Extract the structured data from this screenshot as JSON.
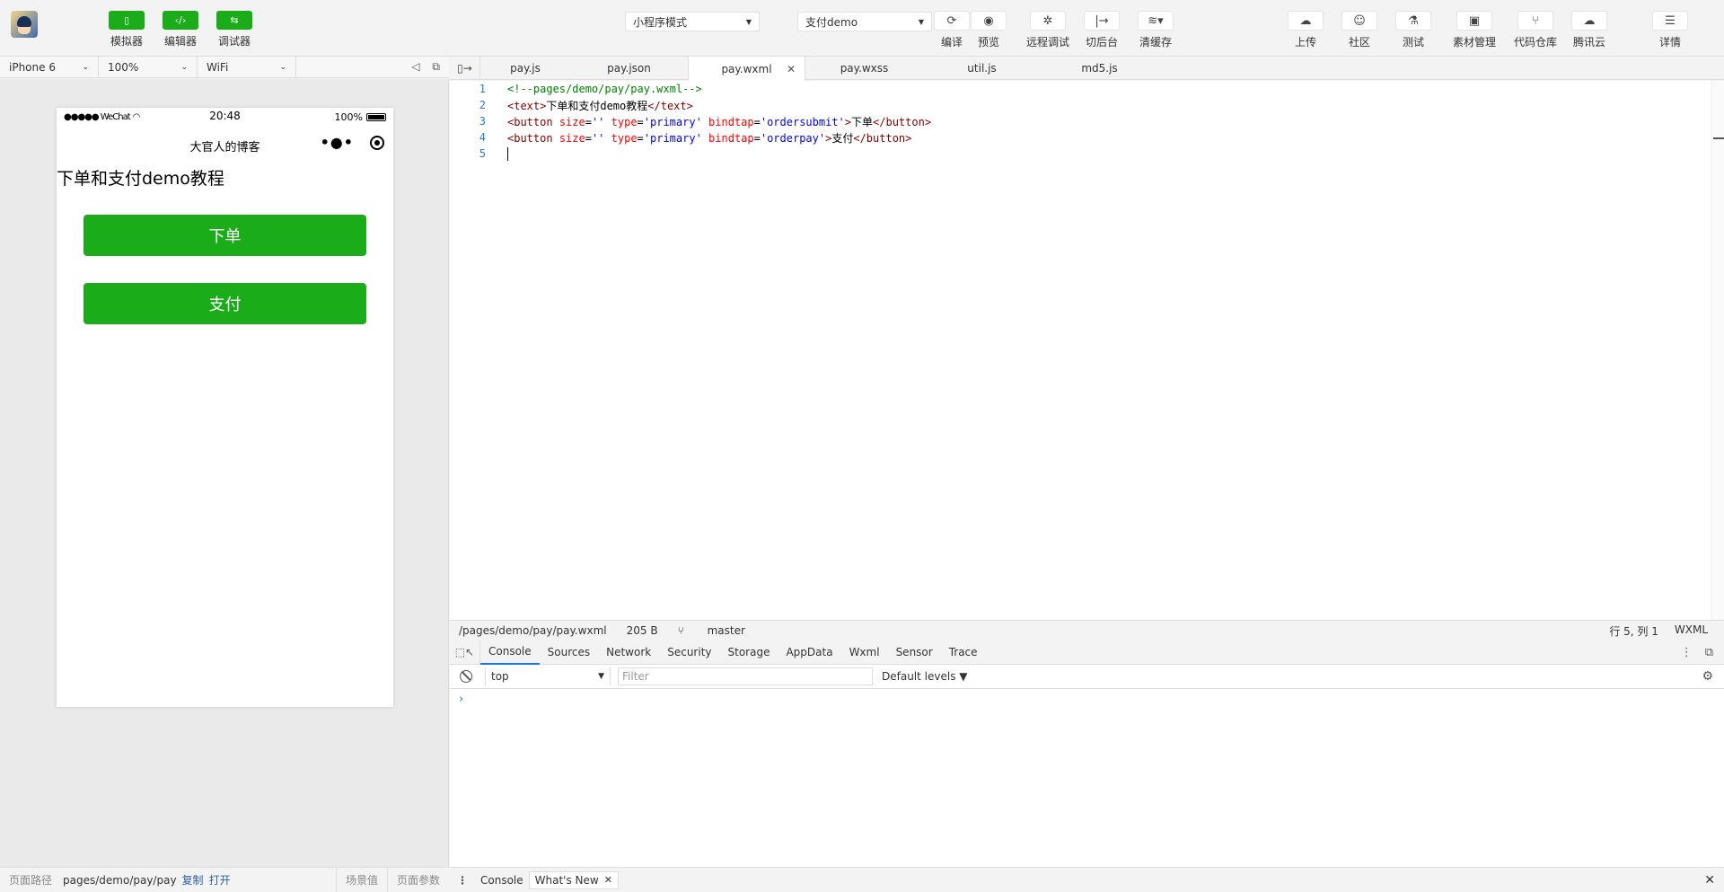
{
  "toolbar": {
    "simulator_label": "模拟器",
    "editor_label": "编辑器",
    "debugger_label": "调试器",
    "mode_select": "小程序模式",
    "project_select": "支付demo",
    "compile_label": "编译",
    "preview_label": "预览",
    "remote_debug_label": "远程调试",
    "background_label": "切后台",
    "clear_cache_label": "清缓存",
    "upload_label": "上传",
    "community_label": "社区",
    "test_label": "测试",
    "assets_label": "素材管理",
    "repo_label": "代码仓库",
    "tencent_cloud_label": "腾讯云",
    "details_label": "详情"
  },
  "sim_bar": {
    "device": "iPhone 6",
    "zoom": "100%",
    "network": "WiFi"
  },
  "phone": {
    "carrier": "●●●●● WeChat",
    "time": "20:48",
    "battery": "100%",
    "nav_title": "大官人的博客",
    "page_text": "下单和支付demo教程",
    "btn_order": "下单",
    "btn_pay": "支付"
  },
  "sim_bottom": {
    "path_label": "页面路径",
    "path_value": "pages/demo/pay/pay",
    "copy": "复制",
    "open": "打开",
    "scene": "场景值",
    "params": "页面参数"
  },
  "editor": {
    "tabs": [
      "pay.js",
      "pay.json",
      "pay.wxml",
      "pay.wxss",
      "util.js",
      "md5.js"
    ],
    "active_tab": 2,
    "lines": [
      "1",
      "2",
      "3",
      "4",
      "5"
    ]
  },
  "code": {
    "l1": "<!--pages/demo/pay/pay.wxml-->",
    "l2_open": "<text>",
    "l2_text": "下单和支付demo教程",
    "l2_close": "</text>",
    "btn_open": "<button",
    "attr_size": "size",
    "attr_type": "type",
    "attr_bind": "bindtap",
    "eq": "=",
    "val_empty": "''",
    "val_primary": "'primary'",
    "val_ordersubmit": "'ordersubmit'",
    "val_orderpay": "'orderpay'",
    "gt": ">",
    "l3_text": "下单",
    "l4_text": "支付",
    "btn_close": "</button>"
  },
  "status": {
    "path": "/pages/demo/pay/pay.wxml",
    "size": "205 B",
    "branch": "master",
    "position": "行 5, 列 1",
    "lang": "WXML"
  },
  "devtools": {
    "tabs": [
      "Console",
      "Sources",
      "Network",
      "Security",
      "Storage",
      "AppData",
      "Wxml",
      "Sensor",
      "Trace"
    ],
    "context": "top",
    "filter_placeholder": "Filter",
    "levels": "Default levels ▼",
    "prompt": "›"
  },
  "drawer": {
    "console": "Console",
    "whats_new": "What's New"
  }
}
